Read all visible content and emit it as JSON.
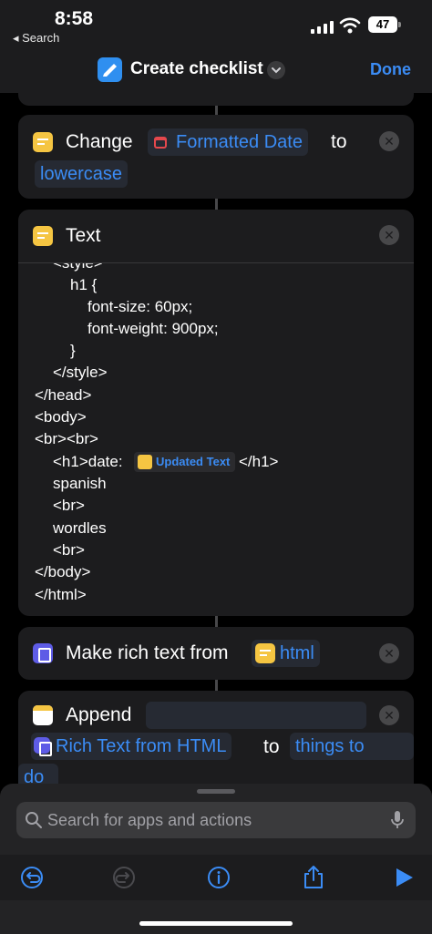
{
  "status": {
    "time": "8:58",
    "back_label": "◂ Search",
    "battery": "47"
  },
  "nav": {
    "title": "Create checklist",
    "done_label": "Done"
  },
  "actions": {
    "change": {
      "verb": "Change",
      "variable": "Formatted Date",
      "connector": "to",
      "option": "lowercase"
    },
    "text": {
      "title": "Text",
      "lines": [
        "<style>",
        "h1 {",
        "font-size: 60px;",
        "font-weight: 900px;",
        "}",
        "</style>",
        "</head>",
        "<body>",
        "<br><br>",
        "<h1>date:",
        "</h1>",
        "spanish",
        "<br>",
        "wordles",
        "<br>",
        "</body>",
        "</html>"
      ],
      "inline_variable": "Updated Text"
    },
    "rich": {
      "verb": "Make rich text from",
      "variable": "html"
    },
    "append": {
      "verb": "Append",
      "variable": "Rich Text from HTML",
      "connector": "to",
      "target": "things to",
      "target_cont": "do"
    }
  },
  "search": {
    "placeholder": "Search for apps and actions"
  },
  "colors": {
    "accent": "#3b8cf5",
    "card": "#1c1c1e",
    "text_icon": "#f5c542",
    "rich_icon": "#5e5ce6",
    "app_icon": "#2f8ff0"
  },
  "icons": [
    "back-arrow-icon",
    "cellular-signal-icon",
    "wifi-icon",
    "battery-icon",
    "shortcut-app-icon",
    "chevron-down-icon",
    "calendar-icon",
    "text-icon",
    "rich-text-icon",
    "notes-icon",
    "close-icon",
    "search-icon",
    "microphone-icon",
    "undo-icon",
    "redo-icon",
    "info-icon",
    "share-icon",
    "play-icon"
  ]
}
